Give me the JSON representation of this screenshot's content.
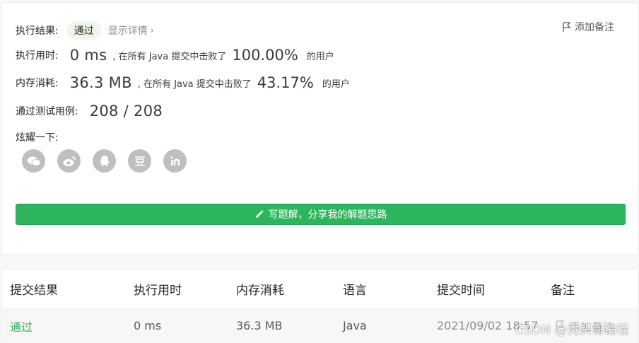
{
  "result": {
    "label": "执行结果:",
    "status": "通过",
    "detail_link": "显示详情",
    "add_note": "添加备注"
  },
  "runtime": {
    "label": "执行用时:",
    "value": "0 ms",
    "beat_text": ", 在所有 Java 提交中击败了",
    "percent": "100.00%",
    "suffix": "的用户"
  },
  "memory": {
    "label": "内存消耗:",
    "value": "36.3 MB",
    "beat_text": ", 在所有 Java 提交中击败了",
    "percent": "43.17%",
    "suffix": "的用户"
  },
  "testcases": {
    "label": "通过测试用例:",
    "value": "208 / 208"
  },
  "share": {
    "label": "炫耀一下:",
    "icons": [
      "wechat-icon",
      "weibo-icon",
      "qq-icon",
      "douban-icon",
      "linkedin-icon"
    ]
  },
  "write_button": "写题解，分享我的解题思路",
  "table": {
    "headers": [
      "提交结果",
      "执行用时",
      "内存消耗",
      "语言",
      "提交时间",
      "备注"
    ],
    "row": {
      "result": "通过",
      "runtime": "0 ms",
      "memory": "36.3 MB",
      "language": "Java",
      "time": "2021/09/02 18:57",
      "note": "添加备注"
    }
  },
  "watermark": "CSDN @秃头哥编程",
  "colors": {
    "accent_green": "#2db55d",
    "icon_gray": "#bfbfbf"
  }
}
